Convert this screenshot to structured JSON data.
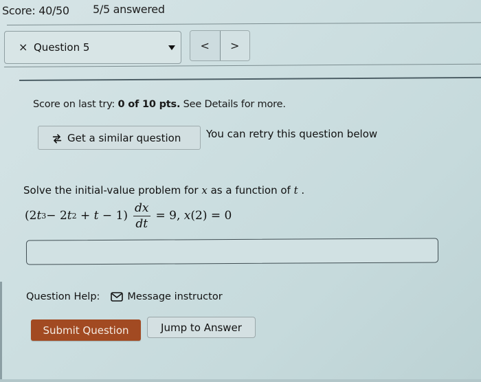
{
  "header": {
    "score": "Score: 40/50",
    "answered": "5/5 answered"
  },
  "question_nav": {
    "close_icon": "×",
    "selected_question": "Question 5",
    "prev_label": "<",
    "next_label": ">"
  },
  "feedback": {
    "prefix": "Score on last try: ",
    "score": "0 of 10 pts.",
    "suffix": " See Details for more."
  },
  "similar": {
    "button_label": "Get a similar question",
    "retry_text": "You can retry this question below"
  },
  "question": {
    "prompt_start": "Solve the initial-value problem for ",
    "var_x": "x",
    "prompt_mid": " as a function of ",
    "var_t": "t",
    "prompt_end": " .",
    "equation": {
      "lhs_open": "(2",
      "t1": "t",
      "exp3": "3",
      "minus": " − 2",
      "t2": "t",
      "exp2": "2",
      "plus": " + ",
      "t3": "t",
      "tail": " − 1)",
      "numerator": "dx",
      "denominator": "dt",
      "rhs": "= 9, ",
      "ic_var": "x",
      "ic_rest": "(2) = 0"
    }
  },
  "answer": {
    "value": "",
    "placeholder": ""
  },
  "help": {
    "label": "Question Help:",
    "message_label": "Message instructor"
  },
  "actions": {
    "submit_label": "Submit Question",
    "jump_label": "Jump to Answer"
  },
  "colors": {
    "submit_bg": "#a24a22",
    "page_bg": "#cfe0e2"
  }
}
